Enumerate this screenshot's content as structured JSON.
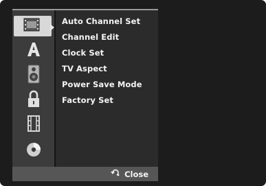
{
  "menu": {
    "categories": [
      {
        "icon": "film-frame-icon",
        "selected": true
      },
      {
        "icon": "letter-a-icon",
        "selected": false
      },
      {
        "icon": "speaker-icon",
        "selected": false
      },
      {
        "icon": "padlock-icon",
        "selected": false
      },
      {
        "icon": "film-strip-icon",
        "selected": false
      },
      {
        "icon": "disc-icon",
        "selected": false
      }
    ],
    "items": [
      {
        "label": "Auto Channel Set"
      },
      {
        "label": "Channel Edit"
      },
      {
        "label": "Clock Set"
      },
      {
        "label": "TV Aspect"
      },
      {
        "label": "Power Save Mode"
      },
      {
        "label": "Factory Set"
      }
    ]
  },
  "footer": {
    "close_label": "Close",
    "close_icon": "return-arrow-icon"
  }
}
